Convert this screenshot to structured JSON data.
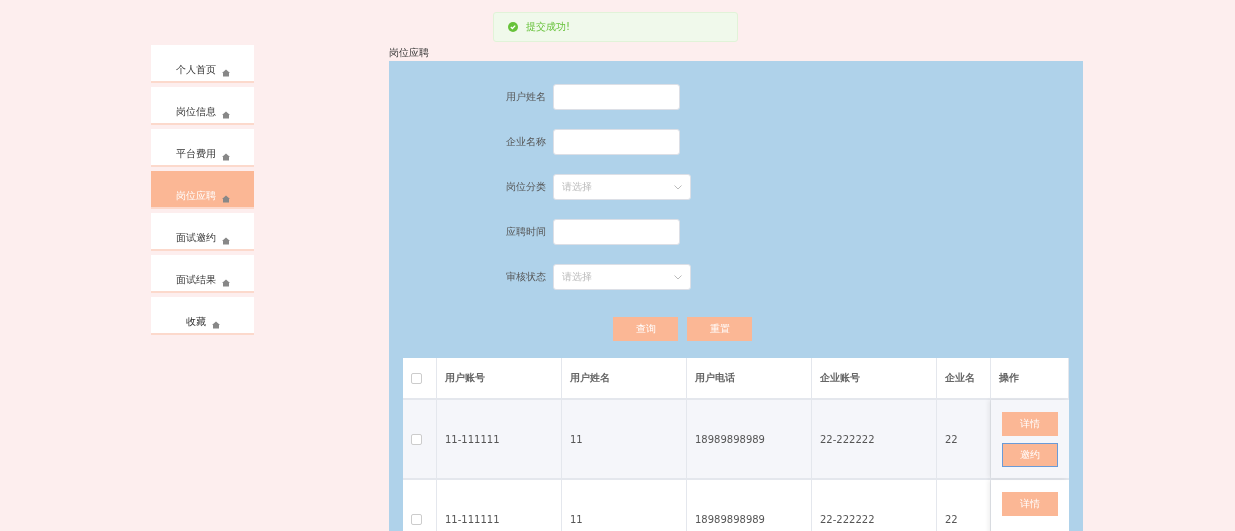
{
  "toast": {
    "kind": "success",
    "message": "提交成功!"
  },
  "sidebar": {
    "items": [
      {
        "label": "个人首页",
        "selected": false
      },
      {
        "label": "岗位信息",
        "selected": false
      },
      {
        "label": "平台费用",
        "selected": false
      },
      {
        "label": "岗位应聘",
        "selected": true
      },
      {
        "label": "面试邀约",
        "selected": false
      },
      {
        "label": "面试结果",
        "selected": false
      },
      {
        "label": "收藏",
        "selected": false
      }
    ]
  },
  "page_title": "岗位应聘",
  "search_form": {
    "fields": [
      {
        "kind": "text",
        "label": "用户姓名"
      },
      {
        "kind": "text",
        "label": "企业名称"
      },
      {
        "kind": "select",
        "label": "岗位分类",
        "placeholder": "请选择"
      },
      {
        "kind": "text",
        "label": "应聘时间"
      },
      {
        "kind": "select",
        "label": "审核状态",
        "placeholder": "请选择"
      }
    ],
    "buttons": [
      "查询",
      "重置"
    ]
  },
  "table": {
    "select_all_checked": false,
    "columns": [
      "用户账号",
      "用户姓名",
      "用户电话",
      "企业账号",
      "企业名"
    ],
    "action_column": "操作",
    "rows": [
      {
        "checked": false,
        "cells": [
          "11-111111",
          "11",
          "18989898989",
          "22-222222",
          "22"
        ],
        "actions": [
          "详情",
          "邀约"
        ]
      },
      {
        "checked": false,
        "cells": [
          "11-111111",
          "11",
          "18989898989",
          "22-222222",
          "22"
        ],
        "actions": [
          "详情"
        ]
      }
    ]
  }
}
